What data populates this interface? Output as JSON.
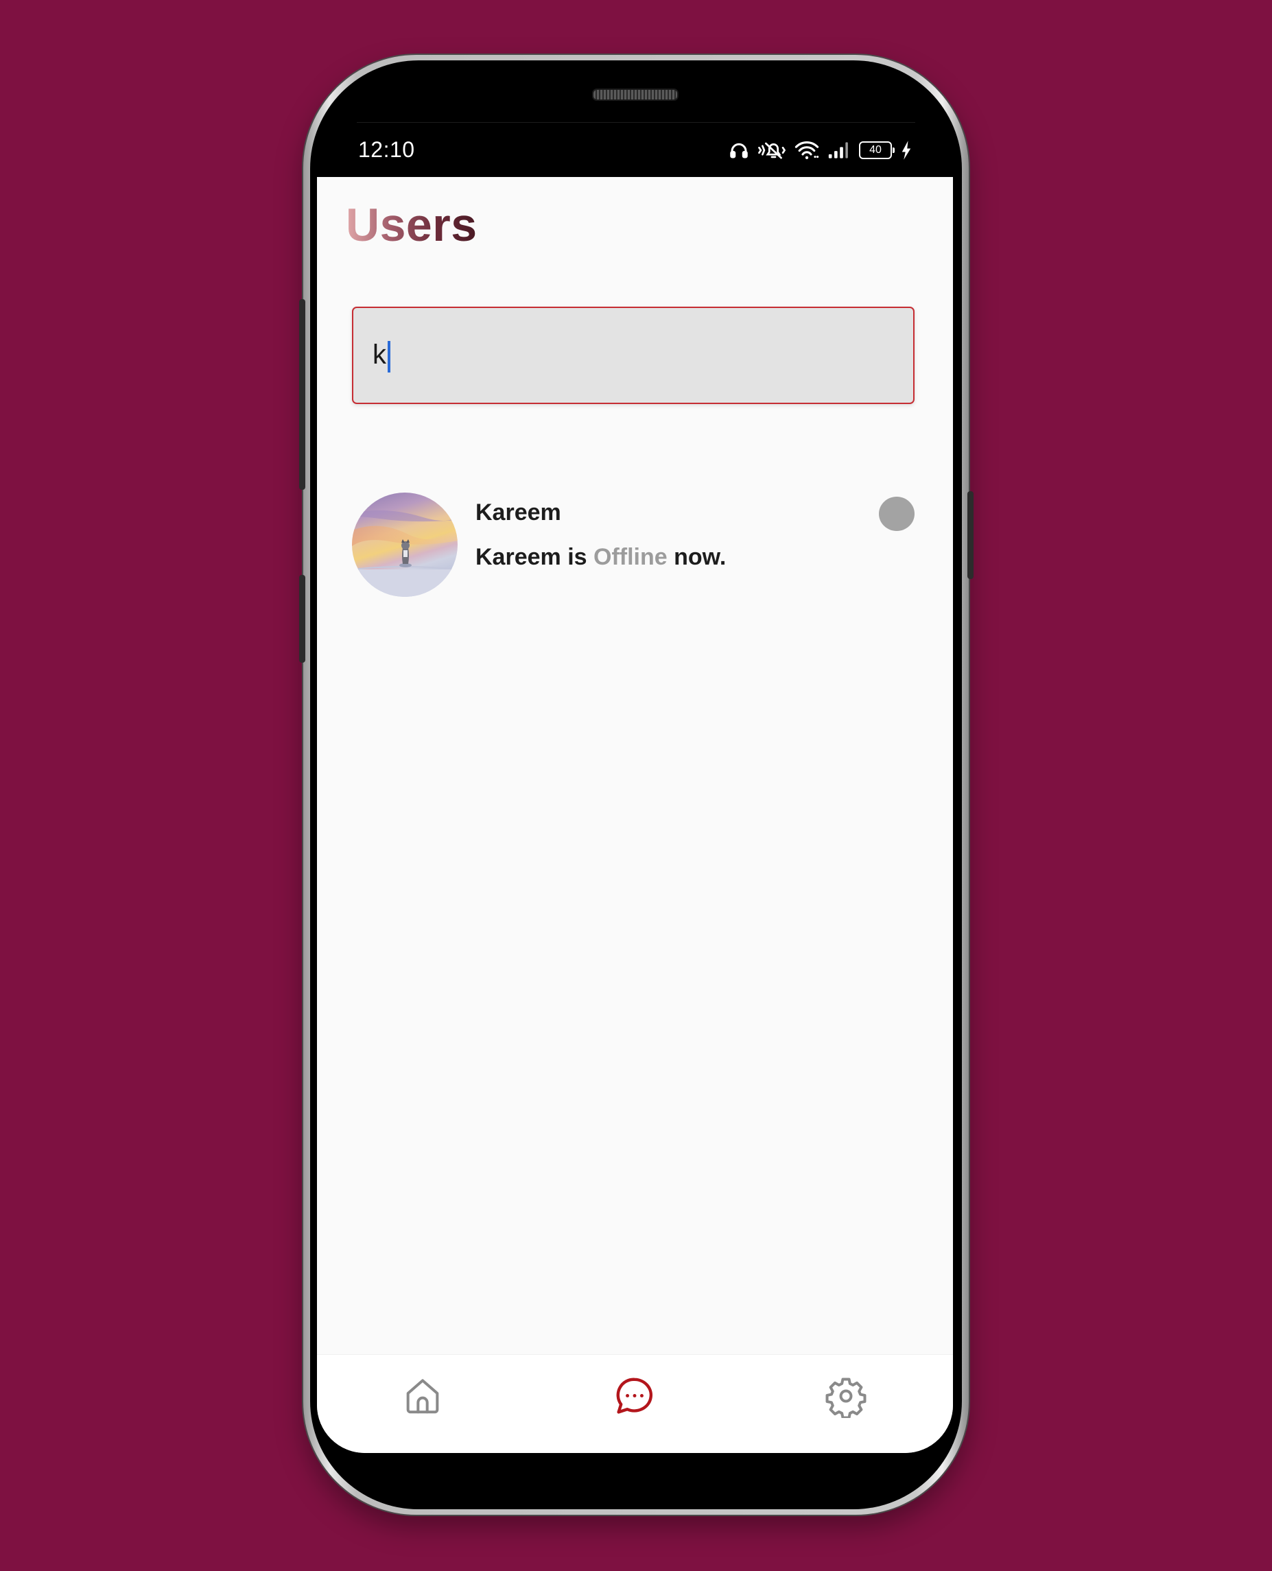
{
  "status_bar": {
    "time": "12:10",
    "battery_level": "40",
    "icons": [
      "headphones-icon",
      "vibrate-mute-icon",
      "wifi-icon",
      "signal-icon",
      "battery-icon",
      "charging-icon"
    ]
  },
  "page": {
    "title": "Users",
    "title_gradient": [
      "#e0a6a8",
      "#4a1a24"
    ]
  },
  "search": {
    "value": "k",
    "border_color": "#c62d33"
  },
  "users": [
    {
      "name": "Kareem",
      "status_prefix": "Kareem is ",
      "status_word": "Offline",
      "status_suffix": " now.",
      "online": false,
      "status_color": "#a3a3a3"
    }
  ],
  "nav": {
    "items": [
      {
        "icon": "home-icon",
        "active": false
      },
      {
        "icon": "chat-icon",
        "active": true
      },
      {
        "icon": "gear-icon",
        "active": false
      }
    ],
    "active_color": "#b3161c",
    "inactive_color": "#8a8a8a"
  },
  "colors": {
    "background": "#7e1141",
    "screen": "#fafafa"
  }
}
